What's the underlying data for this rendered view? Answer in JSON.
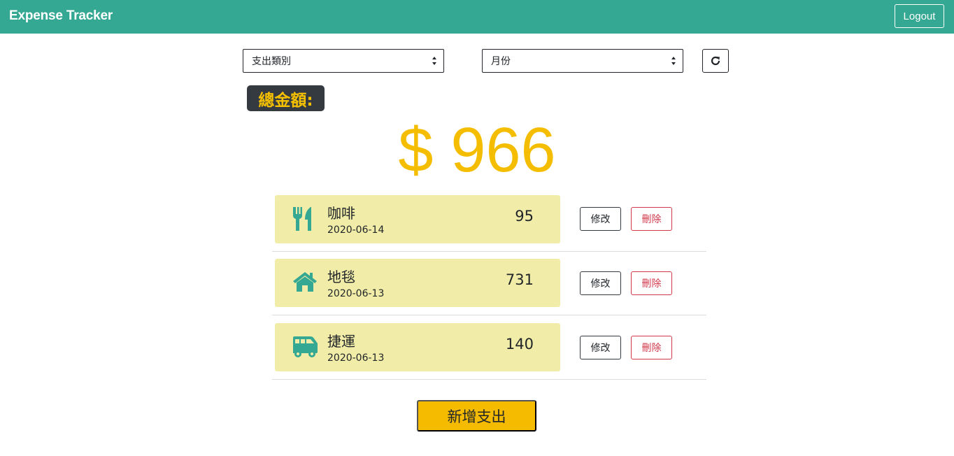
{
  "navbar": {
    "brand": "Expense Tracker",
    "logout_label": "Logout"
  },
  "filters": {
    "category_selected": "支出類別",
    "month_selected": "月份",
    "refresh_icon": "refresh-icon"
  },
  "summary": {
    "label": "總金額:",
    "amount": "$ 966"
  },
  "records": [
    {
      "icon": "utensils-icon",
      "name": "咖啡",
      "date": "2020-06-14",
      "amount": "95",
      "edit_label": "修改",
      "delete_label": "刪除"
    },
    {
      "icon": "home-icon",
      "name": "地毯",
      "date": "2020-06-13",
      "amount": "731",
      "edit_label": "修改",
      "delete_label": "刪除"
    },
    {
      "icon": "shuttle-van-icon",
      "name": "捷運",
      "date": "2020-06-13",
      "amount": "140",
      "edit_label": "修改",
      "delete_label": "刪除"
    }
  ],
  "add_button_label": "新增支出",
  "colors": {
    "navbar": "#35a893",
    "accent_yellow": "#f5bd00",
    "card_bg": "#f1eda8",
    "icon_teal": "#35a893",
    "danger": "#d0384b"
  }
}
